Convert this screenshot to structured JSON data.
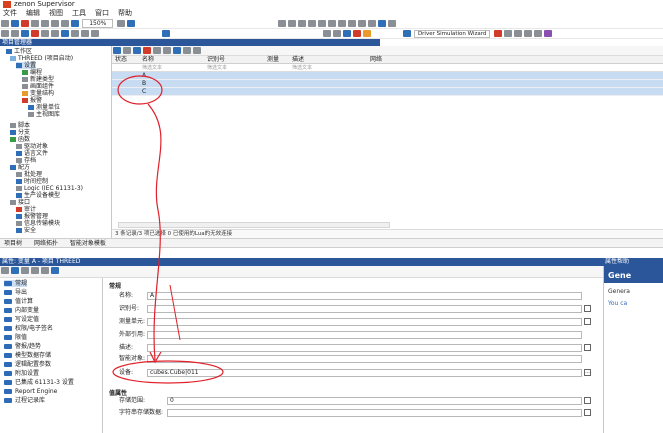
{
  "app": {
    "title": "zenon Supervisor"
  },
  "menu": [
    "文件",
    "编辑",
    "视图",
    "工具",
    "窗口",
    "帮助"
  ],
  "toolbar": {
    "zoom": "150%",
    "sim_dropdown": "Driver Simulation Wizard"
  },
  "project_panel": {
    "header": "项目管理器",
    "root": "工作区",
    "project": "THREED (项目启动)",
    "items": [
      "设置",
      "编程",
      "新建类型",
      "画面组件",
      "变量结构",
      "报警",
      "测量单位",
      "主视图库",
      "脚本",
      "分支",
      "函数",
      "驱动对象",
      "语言文件",
      "存档",
      "配方",
      "批处理",
      "时间控制",
      "Logic (IEC 61131-3)",
      "生产设备模型",
      "接口",
      "审计",
      "报警管理",
      "信息传输模块",
      "安全"
    ]
  },
  "list": {
    "headers": [
      "状态",
      "名称",
      "识别号",
      "测量",
      "描述",
      "网络"
    ],
    "filter_placeholder": "筛选文本",
    "rows": [
      "A",
      "B",
      "C"
    ],
    "status": "3 条记录/3 项已选择    0 已使用的Lua的无效连接"
  },
  "bottom_tabs": [
    "项目树",
    "网络拓扑",
    "智能对象模板"
  ],
  "properties": {
    "header": "属性: 变量 A - 项目 THREED",
    "right_header": "属性帮助",
    "categories": [
      "常规",
      "导出",
      "值计算",
      "内部变量",
      "写设定值",
      "权限/电子签名",
      "限值",
      "警报/趋势",
      "模型数据存储",
      "逻辑配置参数",
      "附加设置",
      "已集成 61131-3 设置",
      "Report Engine",
      "过程记录库"
    ],
    "section_general": "常规",
    "fields": [
      {
        "label": "名称:",
        "value": "A"
      },
      {
        "label": "识别号:",
        "value": ""
      },
      {
        "label": "测量单元:",
        "value": ""
      },
      {
        "label": "外部引用:",
        "value": ""
      },
      {
        "label": "描述:",
        "value": ""
      },
      {
        "label": "智能对象:",
        "value": ""
      },
      {
        "label": "设备:",
        "value": "cubes.Cube|011"
      }
    ],
    "section_range": "值属性",
    "fields2": [
      {
        "label": "存储范围:",
        "value": "0"
      },
      {
        "label": "字符串存储数据:",
        "value": ""
      }
    ],
    "help_title": "Gene",
    "help_line1": "Genera",
    "help_line2": "You ca"
  },
  "colors": {
    "accent": "#2b579a",
    "annotation": "#e0202b",
    "selection": "#c7dcf3"
  }
}
